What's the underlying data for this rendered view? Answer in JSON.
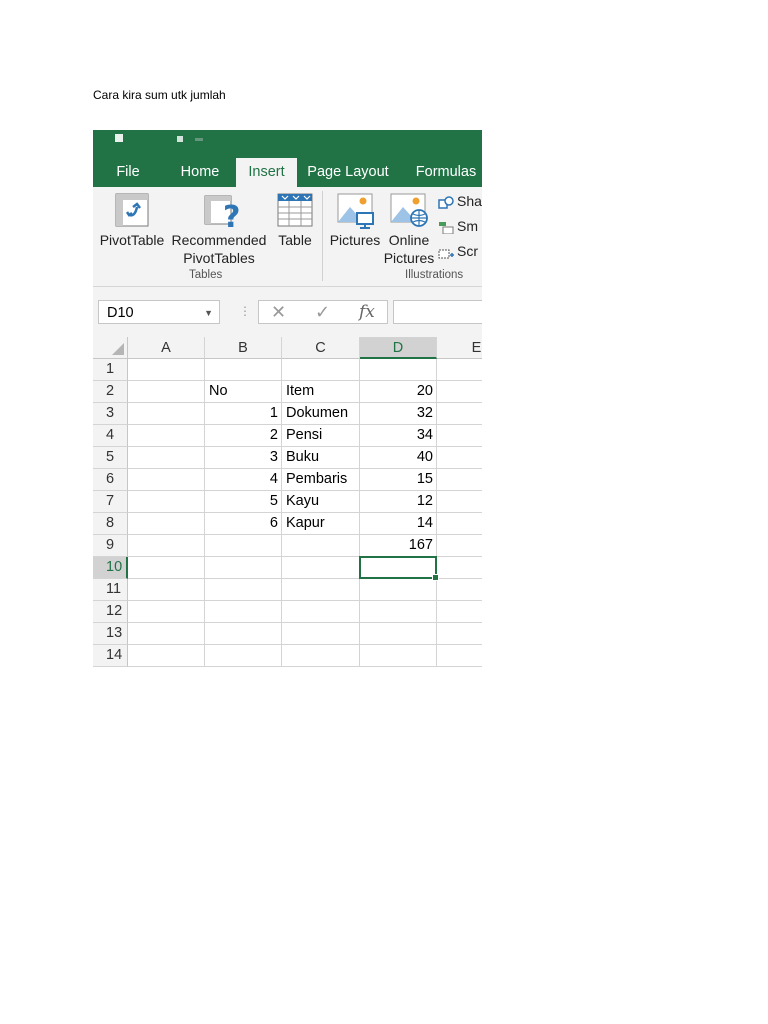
{
  "document": {
    "caption": "Cara kira sum utk jumlah"
  },
  "ribbon": {
    "tabs": [
      "File",
      "Home",
      "Insert",
      "Page Layout",
      "Formulas"
    ],
    "active_tab": "Insert",
    "pivottable": "PivotTable",
    "recommended_1": "Recommended",
    "recommended_2": "PivotTables",
    "table": "Table",
    "tables_group": "Tables",
    "pictures": "Pictures",
    "online_1": "Online",
    "online_2": "Pictures",
    "illustrations_group": "Illustrations",
    "shapes_trunc": "Sha",
    "smartart_trunc": "Sm",
    "screenshot_trunc": "Scr"
  },
  "formula_bar": {
    "name_box": "D10",
    "cancel_icon": "✕",
    "enter_icon": "✓",
    "fx_label": "fx",
    "value": ""
  },
  "grid": {
    "columns": [
      "A",
      "B",
      "C",
      "D",
      "E"
    ],
    "selected_column": "D",
    "selected_cell": "D10",
    "row_numbers": [
      "1",
      "2",
      "3",
      "4",
      "5",
      "6",
      "7",
      "8",
      "9",
      "10",
      "11",
      "12",
      "13",
      "14"
    ],
    "cells": {
      "B2": "No",
      "C2": "Item",
      "D2": "20",
      "B3": "1",
      "C3": "Dokumen",
      "D3": "32",
      "B4": "2",
      "C4": "Pensi",
      "D4": "34",
      "B5": "3",
      "C5": "Buku",
      "D5": "40",
      "B6": "4",
      "C6": "Pembaris",
      "D6": "15",
      "B7": "5",
      "C7": "Kayu",
      "D7": "12",
      "B8": "6",
      "C8": "Kapur",
      "D8": "14",
      "D9": "167"
    }
  },
  "colors": {
    "excel_green": "#217346",
    "ribbon_bg": "#f3f3f3",
    "header_selected": "#d2d2d2"
  }
}
